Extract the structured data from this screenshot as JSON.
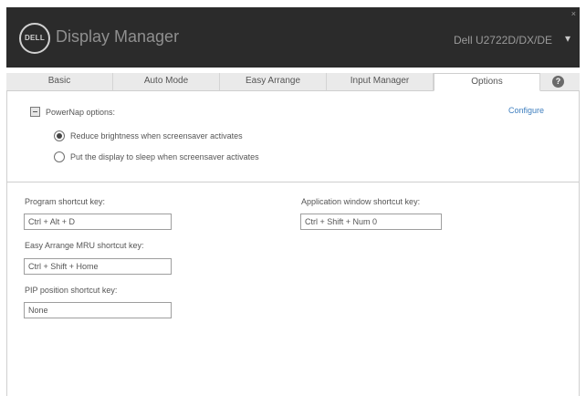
{
  "window": {
    "app_title": "Display Manager",
    "logo_text": "DELL",
    "monitor_name": "Dell U2722D/DX/DE",
    "monitor_dropdown_icon": "chevron-down-icon",
    "close_icon": "close-icon"
  },
  "tabs": [
    {
      "label": "Basic",
      "active": false
    },
    {
      "label": "Auto Mode",
      "active": false
    },
    {
      "label": "Easy Arrange",
      "active": false
    },
    {
      "label": "Input Manager",
      "active": false
    },
    {
      "label": "Options",
      "active": true
    }
  ],
  "help": {
    "icon": "help-icon",
    "glyph": "?"
  },
  "powernap": {
    "checkbox_label": "PowerNap options:",
    "checked": "indeterminate",
    "configure_link": "Configure",
    "options": [
      {
        "label": "Reduce brightness when screensaver activates",
        "selected": true
      },
      {
        "label": "Put the display to sleep when screensaver activates",
        "selected": false
      }
    ]
  },
  "shortcuts": {
    "program": {
      "label": "Program shortcut key:",
      "value": "Ctrl + Alt + D"
    },
    "application_window": {
      "label": "Application window shortcut key:",
      "value": "Ctrl + Shift + Num 0"
    },
    "easy_arrange_mru": {
      "label": "Easy Arrange MRU shortcut key:",
      "value": "Ctrl + Shift + Home"
    },
    "pip_position": {
      "label": "PIP position shortcut key:",
      "value": "None"
    }
  },
  "colors": {
    "titlebar": "#2b2b2b",
    "link": "#3f7fbf",
    "tab_strip": "#eaeaea"
  }
}
